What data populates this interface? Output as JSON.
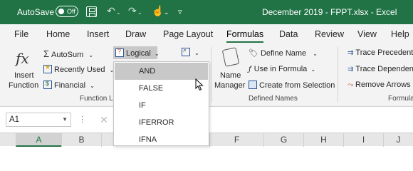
{
  "titlebar": {
    "autosave_label": "AutoSave",
    "autosave_state": "Off",
    "title": "December 2019 - FPPT.xlsx  -  Excel"
  },
  "tabs": [
    "File",
    "Home",
    "Insert",
    "Draw",
    "Page Layout",
    "Formulas",
    "Data",
    "Review",
    "View",
    "Help"
  ],
  "active_tab": "Formulas",
  "ribbon": {
    "insert_function": {
      "glyph": "fx",
      "line1": "Insert",
      "line2": "Function"
    },
    "autosum": "AutoSum",
    "recently_used": "Recently Used",
    "financial": "Financial",
    "logical": "Logical",
    "lookup_glyph": "⌕",
    "function_library_label": "Function L",
    "name_manager": {
      "line1": "Name",
      "line2": "Manager"
    },
    "define_name": "Define Name",
    "use_in_formula": "Use in Formula",
    "create_from_selection": "Create from Selection",
    "defined_names_label": "Defined Names",
    "trace_precedents": "Trace Precedent",
    "trace_dependents": "Trace Dependen",
    "remove_arrows": "Remove Arrows",
    "formula_auditing_label": "Formula"
  },
  "formula_bar": {
    "name_box": "A1",
    "dots": "⋮",
    "cancel": "✕"
  },
  "columns": [
    "A",
    "B",
    "F",
    "G",
    "H",
    "I",
    "J"
  ],
  "selected_column": "A",
  "logical_menu": {
    "items": [
      "AND",
      "FALSE",
      "IF",
      "IFERROR",
      "IFNA"
    ],
    "hovered": "AND"
  },
  "colors": {
    "excel_green": "#217346",
    "ribbon_bg": "#f3f3f3",
    "hover_gray": "#c8c8c8"
  }
}
